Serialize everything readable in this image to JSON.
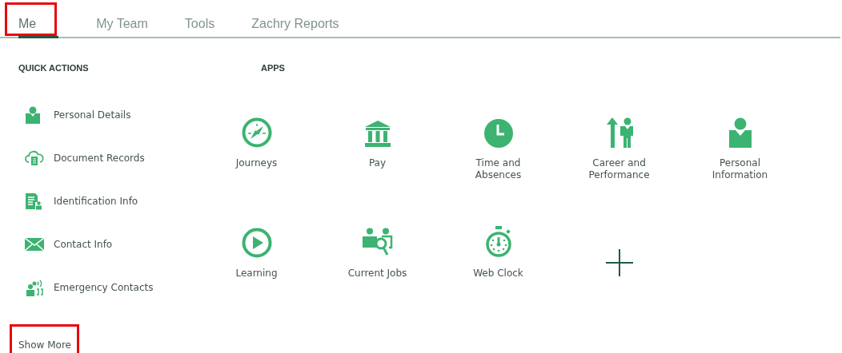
{
  "tabs": [
    {
      "label": "Me",
      "selected": true,
      "highlighted": true
    },
    {
      "label": "My Team",
      "selected": false,
      "highlighted": false
    },
    {
      "label": "Tools",
      "selected": false,
      "highlighted": false
    },
    {
      "label": "Zachry Reports",
      "selected": false,
      "highlighted": false
    }
  ],
  "quick_actions": {
    "heading": "QUICK ACTIONS",
    "items": [
      {
        "label": "Personal Details"
      },
      {
        "label": "Document Records"
      },
      {
        "label": "Identification Info"
      },
      {
        "label": "Contact Info"
      },
      {
        "label": "Emergency Contacts"
      }
    ],
    "show_more": {
      "label": "Show More",
      "highlighted": true
    }
  },
  "apps": {
    "heading": "APPS",
    "items": [
      {
        "kind": "app",
        "label": "Journeys"
      },
      {
        "kind": "app",
        "label": "Pay"
      },
      {
        "kind": "app",
        "label": "Time and Absences"
      },
      {
        "kind": "app",
        "label": "Career and Performance"
      },
      {
        "kind": "app",
        "label": "Personal Information"
      },
      {
        "kind": "app",
        "label": "Learning"
      },
      {
        "kind": "app",
        "label": "Current Jobs"
      },
      {
        "kind": "app",
        "label": "Web Clock"
      },
      {
        "kind": "add"
      }
    ]
  }
}
